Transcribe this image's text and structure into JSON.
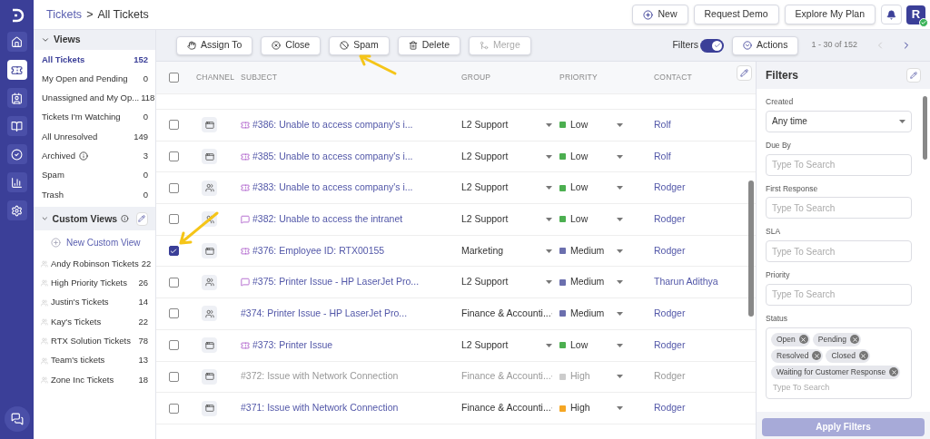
{
  "breadcrumb": {
    "link": "Tickets",
    "separator": ">",
    "current": "All Tickets"
  },
  "header_buttons": [
    {
      "kind": "new",
      "label": "New"
    },
    {
      "kind": "plain",
      "label": "Request Demo"
    },
    {
      "kind": "plain",
      "label": "Explore My Plan"
    }
  ],
  "avatar": {
    "initial": "R",
    "online": true
  },
  "rail": [
    {
      "selected": false
    },
    {
      "selected": true
    },
    {
      "selected": false
    },
    {
      "selected": false
    },
    {
      "selected": false
    },
    {
      "selected": false
    },
    {
      "selected": false
    }
  ],
  "views": {
    "title": "Views",
    "expanded": true,
    "items": [
      {
        "label": "All Tickets",
        "count": "152",
        "selected": true,
        "info": false
      },
      {
        "label": "My Open and Pending",
        "count": "0",
        "selected": false,
        "info": false
      },
      {
        "label": "Unassigned and My Op...",
        "count": "118",
        "selected": false,
        "info": false
      },
      {
        "label": "Tickets I'm Watching",
        "count": "0",
        "selected": false,
        "info": false
      },
      {
        "label": "All Unresolved",
        "count": "149",
        "selected": false,
        "info": false
      },
      {
        "label": "Archived",
        "count": "3",
        "selected": false,
        "info": true
      },
      {
        "label": "Spam",
        "count": "0",
        "selected": false,
        "info": false
      },
      {
        "label": "Trash",
        "count": "0",
        "selected": false,
        "info": false
      }
    ]
  },
  "custom_views": {
    "title": "Custom Views",
    "expanded": true,
    "new_label": "New Custom View",
    "items": [
      {
        "label": "Andy Robinson Tickets",
        "count": "22"
      },
      {
        "label": "High Priority Tickets",
        "count": "26"
      },
      {
        "label": "Justin's Tickets",
        "count": "14"
      },
      {
        "label": "Kay's Tickets",
        "count": "22"
      },
      {
        "label": "RTX Solution Tickets",
        "count": "78"
      },
      {
        "label": "Team's tickets",
        "count": "13"
      },
      {
        "label": "Zone Inc Tickets",
        "count": "18"
      }
    ]
  },
  "toolbar": {
    "actions": [
      {
        "kind": "assign",
        "label": "Assign To",
        "disabled": false
      },
      {
        "kind": "close",
        "label": "Close",
        "disabled": false
      },
      {
        "kind": "spam",
        "label": "Spam",
        "disabled": false
      },
      {
        "kind": "delete",
        "label": "Delete",
        "disabled": false
      },
      {
        "kind": "merge",
        "label": "Merge",
        "disabled": true
      }
    ],
    "filters_label": "Filters",
    "filters_on": true,
    "actions_label": "Actions",
    "pagination": "1 - 30 of 152",
    "prev_disabled": true,
    "next_disabled": false
  },
  "table": {
    "columns": [
      "CHANNEL",
      "SUBJECT",
      "GROUP",
      "PRIORITY",
      "CONTACT"
    ],
    "all_checked": false,
    "rows": [
      {
        "checked": false,
        "kind": "web",
        "ticket_icon": true,
        "chat_icon": false,
        "subject": "#386: Unable to access company's i...",
        "group": "L2 Support",
        "priority": "Low",
        "color": "#4caf50",
        "contact": "Rolf",
        "muted": false
      },
      {
        "checked": false,
        "kind": "web",
        "ticket_icon": true,
        "chat_icon": false,
        "subject": "#385: Unable to access company's i...",
        "group": "L2 Support",
        "priority": "Low",
        "color": "#4caf50",
        "contact": "Rolf",
        "muted": false
      },
      {
        "checked": false,
        "kind": "teams",
        "ticket_icon": true,
        "chat_icon": false,
        "subject": "#383: Unable to access company's i...",
        "group": "L2 Support",
        "priority": "Low",
        "color": "#4caf50",
        "contact": "Rodger",
        "muted": false
      },
      {
        "checked": false,
        "kind": "teams",
        "ticket_icon": false,
        "chat_icon": true,
        "subject": "#382: Unable to access the intranet",
        "group": "L2 Support",
        "priority": "Low",
        "color": "#4caf50",
        "contact": "Rodger",
        "muted": false
      },
      {
        "checked": true,
        "kind": "web",
        "ticket_icon": true,
        "chat_icon": false,
        "subject": "#376: Employee ID: RTX00155",
        "group": "Marketing",
        "priority": "Medium",
        "color": "#6b6fae",
        "contact": "Rodger",
        "muted": false
      },
      {
        "checked": false,
        "kind": "teams",
        "ticket_icon": false,
        "chat_icon": true,
        "subject": "#375: Printer Issue - HP LaserJet Pro...",
        "group": "L2 Support",
        "priority": "Medium",
        "color": "#6b6fae",
        "contact": "Tharun Adithya",
        "muted": false
      },
      {
        "checked": false,
        "kind": "teams",
        "ticket_icon": false,
        "chat_icon": false,
        "subject": "#374: Printer Issue - HP LaserJet Pro...",
        "group": "Finance & Accounti...",
        "priority": "Medium",
        "color": "#6b6fae",
        "contact": "Rodger",
        "muted": false
      },
      {
        "checked": false,
        "kind": "web",
        "ticket_icon": true,
        "chat_icon": false,
        "subject": "#373: Printer Issue",
        "group": "L2 Support",
        "priority": "Low",
        "color": "#4caf50",
        "contact": "Rodger",
        "muted": false
      },
      {
        "checked": false,
        "kind": "web",
        "ticket_icon": false,
        "chat_icon": false,
        "subject": "#372: Issue with Network Connection",
        "group": "Finance & Accounti...",
        "priority": "High",
        "color": "#cccccc",
        "contact": "Rodger",
        "muted": true
      },
      {
        "checked": false,
        "kind": "web",
        "ticket_icon": false,
        "chat_icon": false,
        "subject": "#371: Issue with Network Connection",
        "group": "Finance & Accounti...",
        "priority": "High",
        "color": "#f5a623",
        "contact": "Rodger",
        "muted": false
      }
    ]
  },
  "filters_panel": {
    "title": "Filters",
    "fields": [
      {
        "kind": "select",
        "label": "Created",
        "value": "Any time"
      },
      {
        "kind": "search",
        "label": "Due By",
        "placeholder": "Type To Search"
      },
      {
        "kind": "search",
        "label": "First Response",
        "placeholder": "Type To Search"
      },
      {
        "kind": "search",
        "label": "SLA",
        "placeholder": "Type To Search"
      },
      {
        "kind": "search",
        "label": "Priority",
        "placeholder": "Type To Search"
      },
      {
        "kind": "chips",
        "label": "Status",
        "chips": [
          "Open",
          "Pending",
          "Resolved",
          "Closed",
          "Waiting for Customer Response"
        ],
        "placeholder": "Type To Search"
      }
    ],
    "apply_label": "Apply Filters",
    "apply_disabled": true
  }
}
